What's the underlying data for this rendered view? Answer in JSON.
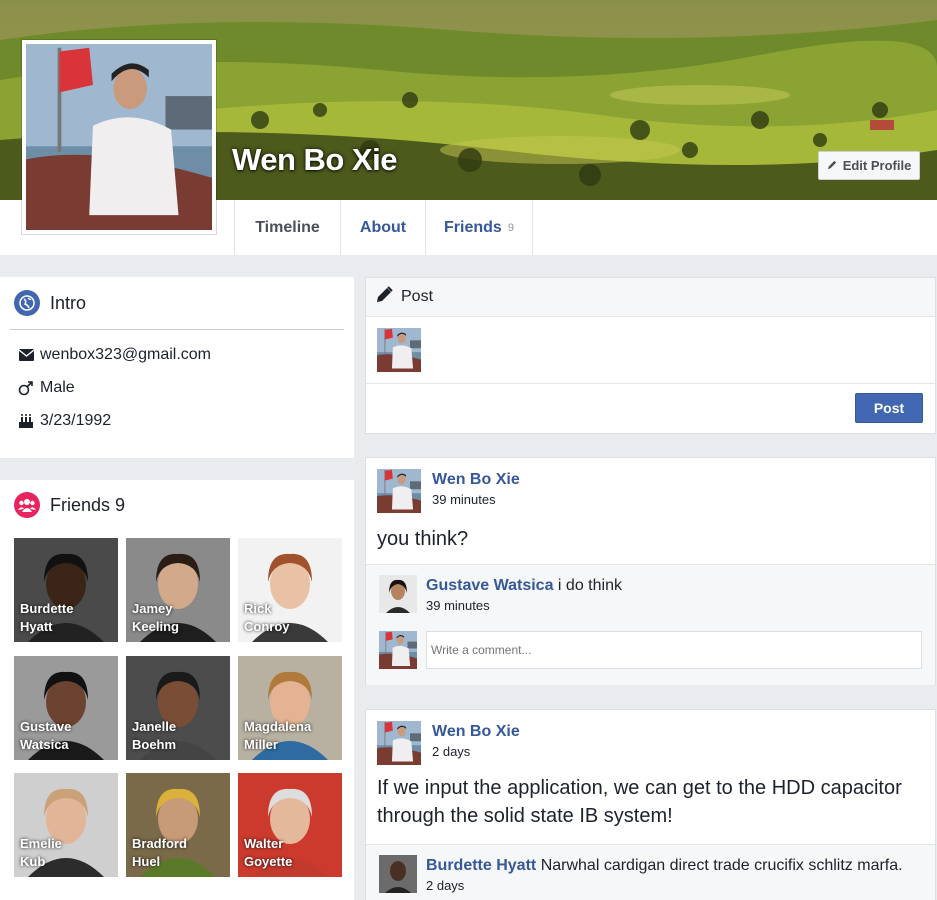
{
  "profile": {
    "name": "Wen Bo Xie",
    "edit_label": "Edit Profile"
  },
  "nav": {
    "tabs": [
      {
        "label": "Timeline"
      },
      {
        "label": "About"
      },
      {
        "label": "Friends",
        "count": "9"
      }
    ]
  },
  "intro": {
    "title": "Intro",
    "email": "wenbox323@gmail.com",
    "gender": "Male",
    "birthday": "3/23/1992"
  },
  "friends": {
    "title": "Friends 9",
    "list": [
      {
        "first": "Burdette",
        "last": "Hyatt"
      },
      {
        "first": "Jamey",
        "last": "Keeling"
      },
      {
        "first": "Rick",
        "last": "Conroy"
      },
      {
        "first": "Gustave",
        "last": "Watsica"
      },
      {
        "first": "Janelle",
        "last": "Boehm"
      },
      {
        "first": "Magdalena",
        "last": "Miller"
      },
      {
        "first": "Emelie",
        "last": "Kub"
      },
      {
        "first": "Bradford",
        "last": "Huel"
      },
      {
        "first": "Walter",
        "last": "Goyette"
      }
    ]
  },
  "composer": {
    "title": "Post",
    "button": "Post"
  },
  "posts": [
    {
      "author": "Wen Bo Xie",
      "time": "39 minutes",
      "text": "you think?",
      "comment": {
        "author": "Gustave Watsica",
        "text": "i do think",
        "time": "39 minutes"
      },
      "comment_placeholder": "Write a comment..."
    },
    {
      "author": "Wen Bo Xie",
      "time": "2 days",
      "text": "If we input the application, we can get to the HDD capacitor through the solid state IB system!",
      "comment": {
        "author": "Burdette Hyatt",
        "text": "Narwhal cardigan direct trade crucifix schlitz marfa.",
        "time": "2 days"
      }
    }
  ],
  "colors": {
    "brand": "#4267b2",
    "link": "#365899",
    "friends_icon": "#e8245e"
  },
  "icons": {
    "intro": "globe-icon",
    "email": "envelope-icon",
    "gender": "male-icon",
    "birthday": "cake-icon",
    "friends": "users-icon",
    "composer": "pencil-icon",
    "edit": "pencil-icon"
  }
}
